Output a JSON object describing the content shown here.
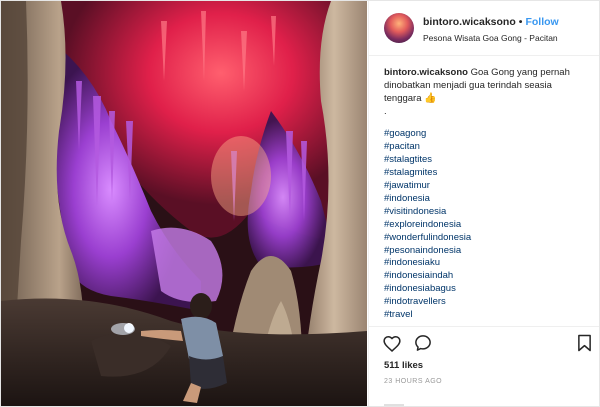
{
  "post": {
    "username": "bintoro.wicaksono",
    "separator": "•",
    "follow_label": "Follow",
    "location": "Pesona Wisata Goa Gong - Pacitan",
    "photo_icon": "cave-photo",
    "caption": {
      "username": "bintoro.wicaksono",
      "text": "Goa Gong yang pernah dinobatkan menjadi gua terindah seasia tenggara",
      "emoji": "👍",
      "dot": "."
    },
    "hashtags": [
      "#goagong",
      "#pacitan",
      "#stalagtites",
      "#stalagmites",
      "#jawatimur",
      "#indonesia",
      "#visitindonesia",
      "#exploreindonesia",
      "#wonderfulindonesia",
      "#pesonaindonesia",
      "#indonesiaku",
      "#indonesiaindah",
      "#indonesiabagus",
      "#indotravellers",
      "#travel"
    ],
    "likes": "511 likes",
    "time": "23 HOURS AGO",
    "icons": {
      "like": "heart-icon",
      "comment": "comment-icon",
      "save": "bookmark-icon"
    },
    "colors": {
      "link": "#3897f0",
      "hashtag": "#003569",
      "muted": "#999999",
      "text": "#262626"
    }
  }
}
